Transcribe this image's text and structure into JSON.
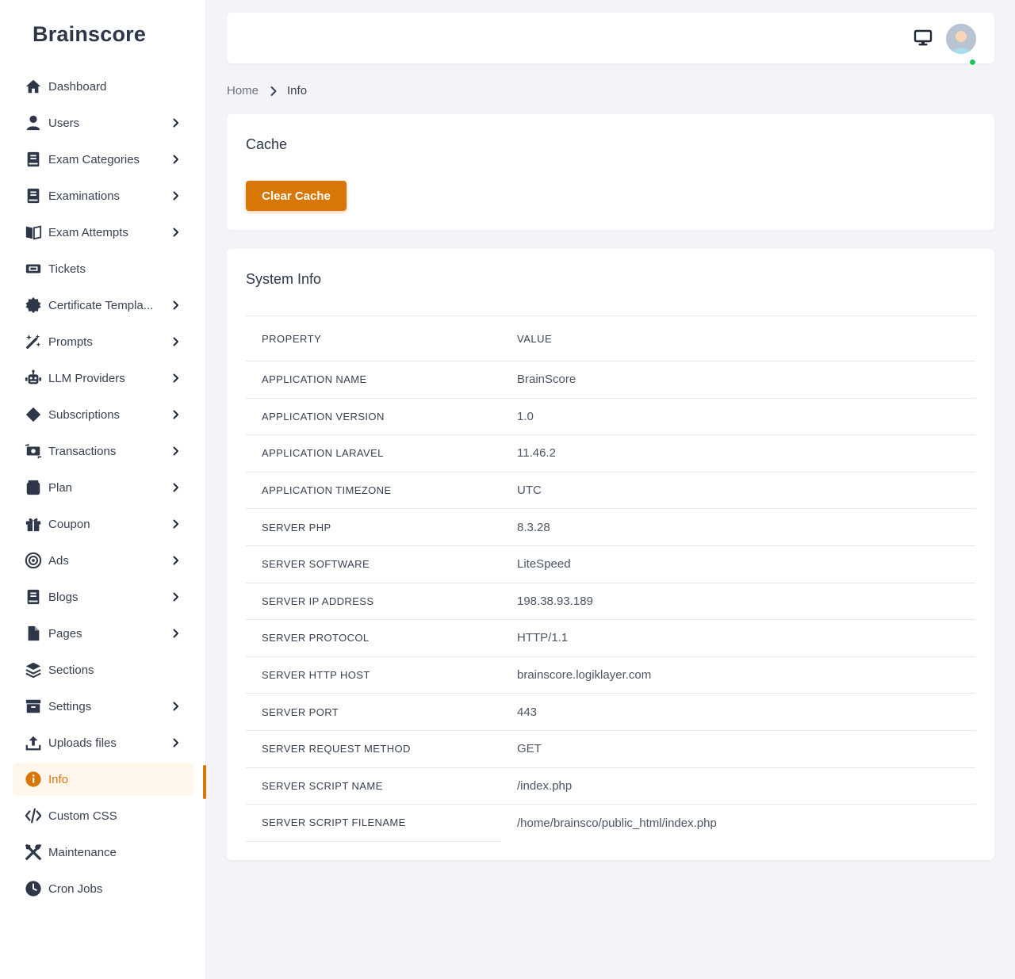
{
  "app": {
    "brand": "Brainscore"
  },
  "sidebar": {
    "items": [
      {
        "label": "Dashboard",
        "icon": "home-icon",
        "chevron": false
      },
      {
        "label": "Users",
        "icon": "user-icon",
        "chevron": true
      },
      {
        "label": "Exam Categories",
        "icon": "book-icon",
        "chevron": true
      },
      {
        "label": "Examinations",
        "icon": "book-icon",
        "chevron": true
      },
      {
        "label": "Exam Attempts",
        "icon": "book-open-icon",
        "chevron": true
      },
      {
        "label": "Tickets",
        "icon": "ticket-icon",
        "chevron": false
      },
      {
        "label": "Certificate Templa...",
        "icon": "certificate-icon",
        "chevron": true
      },
      {
        "label": "Prompts",
        "icon": "magic-wand-icon",
        "chevron": true
      },
      {
        "label": "LLM Providers",
        "icon": "robot-icon",
        "chevron": true
      },
      {
        "label": "Subscriptions",
        "icon": "diamond-icon",
        "chevron": true
      },
      {
        "label": "Transactions",
        "icon": "money-exchange-icon",
        "chevron": true
      },
      {
        "label": "Plan",
        "icon": "box-icon",
        "chevron": true
      },
      {
        "label": "Coupon",
        "icon": "gift-icon",
        "chevron": true
      },
      {
        "label": "Ads",
        "icon": "target-icon",
        "chevron": true
      },
      {
        "label": "Blogs",
        "icon": "book-icon",
        "chevron": true
      },
      {
        "label": "Pages",
        "icon": "file-icon",
        "chevron": true
      },
      {
        "label": "Sections",
        "icon": "layers-icon",
        "chevron": false
      },
      {
        "label": "Settings",
        "icon": "archive-icon",
        "chevron": true
      },
      {
        "label": "Uploads files",
        "icon": "upload-icon",
        "chevron": true
      },
      {
        "label": "Info",
        "icon": "info-icon",
        "chevron": false,
        "active": true
      },
      {
        "label": "Custom CSS",
        "icon": "code-icon",
        "chevron": false
      },
      {
        "label": "Maintenance",
        "icon": "tools-icon",
        "chevron": false
      },
      {
        "label": "Cron Jobs",
        "icon": "clock-icon",
        "chevron": false
      }
    ]
  },
  "topbar": {
    "icons": [
      "monitor-icon",
      "avatar"
    ]
  },
  "breadcrumb": {
    "home": "Home",
    "current": "Info"
  },
  "cache": {
    "title": "Cache",
    "button": "Clear Cache"
  },
  "system_info": {
    "title": "System Info",
    "columns": [
      "PROPERTY",
      "VALUE"
    ],
    "rows": [
      [
        "APPLICATION NAME",
        "BrainScore"
      ],
      [
        "APPLICATION VERSION",
        "1.0"
      ],
      [
        "APPLICATION LARAVEL",
        "11.46.2"
      ],
      [
        "APPLICATION TIMEZONE",
        "UTC"
      ],
      [
        "SERVER PHP",
        "8.3.28"
      ],
      [
        "SERVER SOFTWARE",
        "LiteSpeed"
      ],
      [
        "SERVER IP ADDRESS",
        "198.38.93.189"
      ],
      [
        "SERVER PROTOCOL",
        "HTTP/1.1"
      ],
      [
        "SERVER HTTP HOST",
        "brainscore.logiklayer.com"
      ],
      [
        "SERVER PORT",
        "443"
      ],
      [
        "SERVER REQUEST METHOD",
        "GET"
      ],
      [
        "SERVER SCRIPT NAME",
        "/index.php"
      ],
      [
        "SERVER SCRIPT FILENAME",
        "/home/brainsco/public_html/index.php"
      ]
    ]
  },
  "colors": {
    "accent": "#d97706",
    "accent_bg": "#fff6ec",
    "text": "#374151",
    "online": "#22c55e"
  }
}
